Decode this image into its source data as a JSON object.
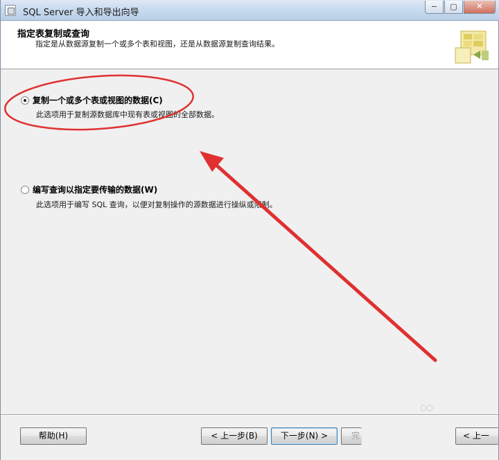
{
  "window": {
    "title": "SQL Server 导入和导出向导",
    "controls": {
      "minimize": "−",
      "maximize": "▢",
      "close": "✕"
    }
  },
  "header": {
    "title": "指定表复制或查询",
    "subtitle": "指定是从数据源复制一个或多个表和视图，还是从数据源复制查询结果。",
    "icon": "wizard-table-icon"
  },
  "options": [
    {
      "label": "复制一个或多个表或视图的数据(C)",
      "description": "此选项用于复制源数据库中现有表或视图的全部数据。",
      "checked": true
    },
    {
      "label": "编写查询以指定要传输的数据(W)",
      "description": "此选项用于编写 SQL 查询，以便对复制操作的源数据进行操纵或限制。",
      "checked": false
    }
  ],
  "buttons": {
    "help": "帮助(H)",
    "back": "< 上一步(B)",
    "next": "下一步(N) >",
    "finish": "完",
    "cancel": "< 上一"
  },
  "annotation": {
    "color": "#e03030"
  }
}
